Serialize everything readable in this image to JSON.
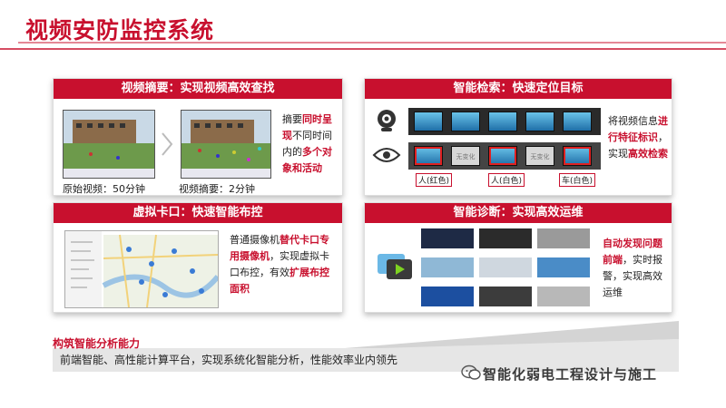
{
  "page": {
    "title": "视频安防监控系统",
    "brand_color": "#c8102e"
  },
  "panels": {
    "video_summary": {
      "header": "视频摘要：实现视频高效查找",
      "caption_original": "原始视频：50分钟",
      "caption_summary": "视频摘要：2分钟",
      "desc": [
        {
          "t": "摘要",
          "hl": false
        },
        {
          "t": "同时呈现",
          "hl": true
        },
        {
          "t": "不同时间内的",
          "hl": false
        },
        {
          "t": "多个对象和活动",
          "hl": true
        }
      ]
    },
    "smart_search": {
      "header": "智能检索：快速定位目标",
      "no_change": "无变化",
      "tags": [
        "人(红色)",
        "人(白色)",
        "车(白色)"
      ],
      "desc": [
        {
          "t": "将视频信息",
          "hl": false
        },
        {
          "t": "进行特征标识",
          "hl": true
        },
        {
          "t": "，实现",
          "hl": false
        },
        {
          "t": "高效检索",
          "hl": true
        }
      ]
    },
    "virtual_checkpoint": {
      "header": "虚拟卡口：快速智能布控",
      "desc": [
        {
          "t": "普通摄像机",
          "hl": false
        },
        {
          "t": "替代卡口专用摄像机",
          "hl": true
        },
        {
          "t": "，实现虚拟卡口布控，有效",
          "hl": false
        },
        {
          "t": "扩展布控面积",
          "hl": true
        }
      ]
    },
    "smart_diagnosis": {
      "header": "智能诊断：实现高效运维",
      "desc": [
        {
          "t": "自动发现问题前端",
          "hl": true
        },
        {
          "t": "，实时报警，实现高效运维",
          "hl": false
        }
      ]
    }
  },
  "footer": {
    "heading": "构筑智能分析能力",
    "text": "前端智能、高性能计算平台，实现系统化智能分析，性能效率业内领先",
    "watermark": "智能化弱电工程设计与施工"
  }
}
